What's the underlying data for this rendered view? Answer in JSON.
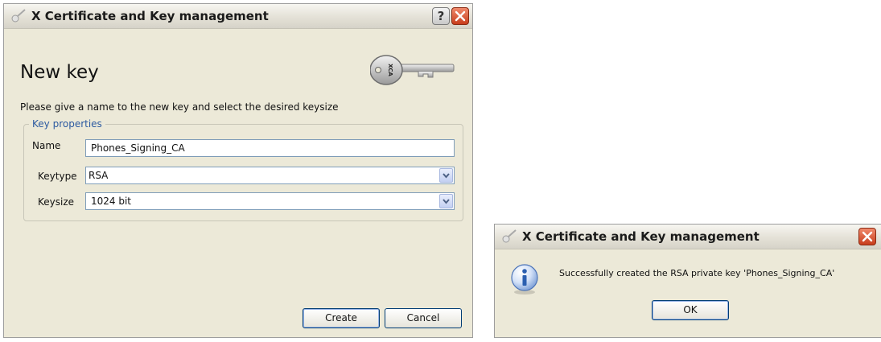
{
  "main_window": {
    "title": "X Certificate and Key management",
    "help_button": "?",
    "heading": "New key",
    "instruction": "Please give a name to the new key and select the desired keysize",
    "group_title": "Key properties",
    "name": {
      "label": "Name",
      "value": "Phones_Signing_CA"
    },
    "keytype": {
      "label": "Keytype",
      "value": "RSA"
    },
    "keysize": {
      "label": "Keysize",
      "value": "1024 bit"
    },
    "create_label": "Create",
    "cancel_label": "Cancel",
    "key_image_text": "XCA"
  },
  "message_window": {
    "title": "X Certificate and Key management",
    "message": "Successfully created the RSA private key 'Phones_Signing_CA'",
    "ok_label": "OK"
  },
  "icons": {
    "app": "key-icon",
    "info": "info-icon",
    "close": "close-icon",
    "help": "help-icon"
  },
  "colors": {
    "window_bg": "#ece9d8",
    "group_title": "#2c5aa0",
    "close_button": "#d8502c",
    "info_blue": "#2b5fb0"
  }
}
